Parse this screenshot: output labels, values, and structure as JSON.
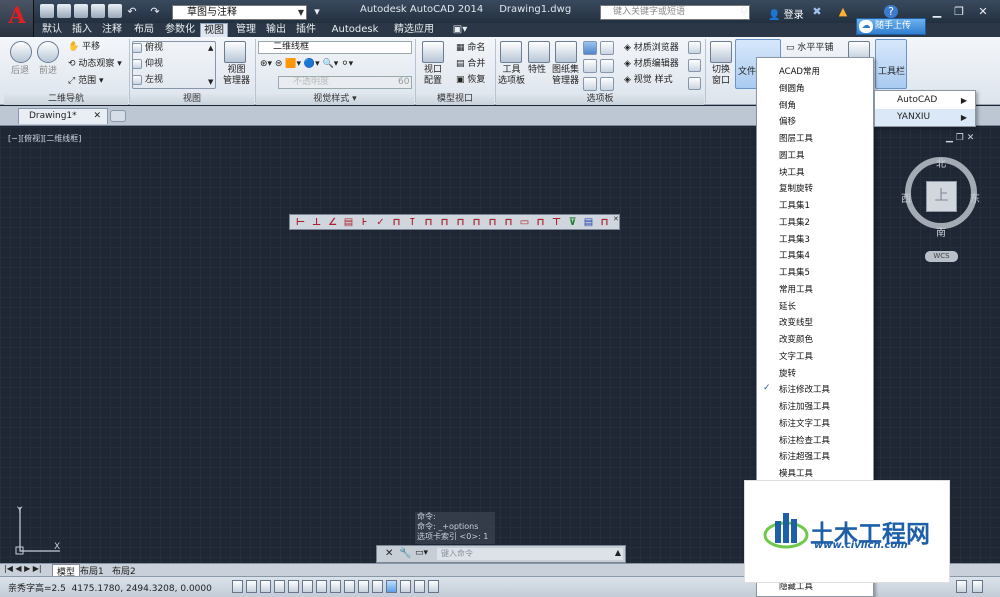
{
  "title_bar": {
    "workspace": "草图与注释",
    "title": "Autodesk AutoCAD 2014",
    "document": "Drawing1.dwg",
    "search_placeholder": "键入关键字或短语",
    "login": "登录",
    "upload": "随手上传"
  },
  "ribbon_tabs": [
    "默认",
    "插入",
    "注释",
    "布局",
    "参数化",
    "视图",
    "管理",
    "输出",
    "插件",
    "Autodesk 360",
    "精选应用"
  ],
  "active_tab": "视图",
  "ribbon": {
    "nav": {
      "back": "后退",
      "forward": "前进",
      "pan": "平移",
      "orbit": "动态观察",
      "extents": "范围",
      "panel": "二维导航"
    },
    "views": {
      "top": "俯视",
      "bottom": "仰视",
      "left": "左视",
      "manager": "视图\n管理器",
      "panel": "视图"
    },
    "visual": {
      "style": "二维线框",
      "panel": "视觉样式",
      "value": "60",
      "slider_text": "不透明度"
    },
    "viewports": {
      "config": "视口\n配置",
      "name": "命名",
      "join": "合并",
      "restore": "恢复",
      "panel": "模型视口"
    },
    "palettes": {
      "tool": "工具\n选项板",
      "props": "特性",
      "sheetset": "图纸集\n管理器",
      "matbrowser": "材质浏览器",
      "mateditor": "材质编辑器",
      "visualstyles": "视觉 样式",
      "panel": "选项板"
    },
    "windows": {
      "switch": "切换\n窗口",
      "filetab": "文件选",
      "tile": "水平平铺",
      "toolbars": "工具栏"
    }
  },
  "doc_tab": "Drawing1*",
  "viewport_label": "[−][俯视][二维线框]",
  "viewcube": {
    "top": "上",
    "n": "北",
    "s": "南",
    "e": "东",
    "w": "西",
    "wcs": "WCS"
  },
  "command": {
    "history": [
      "命令:",
      "命令: _+options",
      "选项卡索引 <0>: 1"
    ],
    "placeholder": "键入命令"
  },
  "layout_tabs": [
    "模型",
    "布局1",
    "布局2"
  ],
  "status": {
    "text": "亲秀字高=2.5  4175.1780, 2494.3208, 0.0000"
  },
  "menu_items": [
    "ACAD常用",
    "倒圆角",
    "倒角",
    "偏移",
    "图层工具",
    "圆工具",
    "块工具",
    "复制旋转",
    "工具集1",
    "工具集2",
    "工具集3",
    "工具集4",
    "工具集5",
    "常用工具",
    "延长",
    "改变线型",
    "改变颜色",
    "文字工具",
    "旋转",
    "标注修改工具",
    "标注加强工具",
    "标注文字工具",
    "标注检查工具",
    "标注超强工具",
    "模具工具"
  ],
  "menu_checked": "标注修改工具",
  "menu_last": "隐藏工具",
  "submenu": [
    "AutoCAD",
    "YANXIU"
  ],
  "watermark": {
    "title": "土木工程网",
    "url": "www.civilcn.com"
  }
}
